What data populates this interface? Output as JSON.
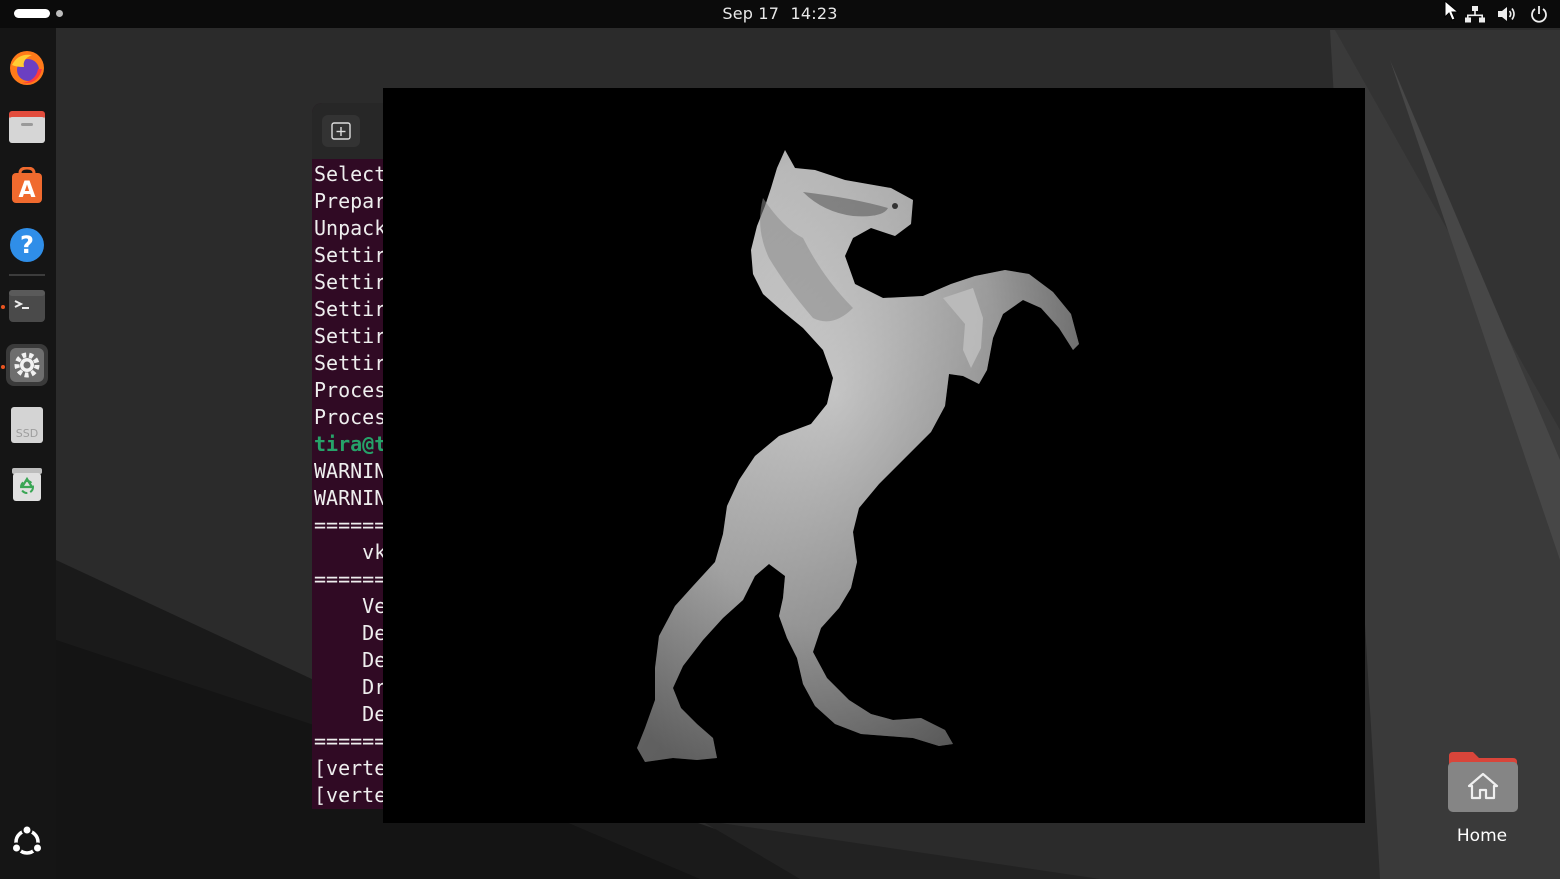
{
  "topbar": {
    "date": "Sep 17",
    "time": "14:23",
    "tray_icons": [
      "network-icon",
      "volume-icon",
      "power-icon"
    ]
  },
  "dock": {
    "items": [
      {
        "name": "firefox-icon",
        "running": false
      },
      {
        "name": "files-icon",
        "running": false
      },
      {
        "name": "app-center-icon",
        "running": false
      },
      {
        "name": "help-icon",
        "running": false
      },
      {
        "name": "terminal-icon",
        "running": true
      },
      {
        "name": "settings-icon",
        "running": true,
        "active": true
      },
      {
        "name": "ssd-drive-icon",
        "running": false
      },
      {
        "name": "trash-icon",
        "running": false
      }
    ],
    "show_apps_icon": "ubuntu-show-apps-icon"
  },
  "terminal": {
    "lines": [
      {
        "text": "Select"
      },
      {
        "text": "Prepar"
      },
      {
        "text": "Unpack"
      },
      {
        "text": "Settir"
      },
      {
        "text": "Settir"
      },
      {
        "text": "Settir"
      },
      {
        "text": "Settir"
      },
      {
        "text": "Settir"
      },
      {
        "text": "Proces"
      },
      {
        "text": "Proces"
      },
      {
        "text": "tira@t",
        "prompt": true
      },
      {
        "text": "WARNIN"
      },
      {
        "text": "WARNIN"
      },
      {
        "text": "======"
      },
      {
        "text": "    vk"
      },
      {
        "text": "======"
      },
      {
        "text": "    Ve"
      },
      {
        "text": "    De"
      },
      {
        "text": "    De"
      },
      {
        "text": "    Dr"
      },
      {
        "text": "    De"
      },
      {
        "text": "======"
      },
      {
        "text": "[verte"
      },
      {
        "text": "[verte"
      }
    ]
  },
  "render_window": {
    "content": "rearing-horse-3d-model",
    "background": "#000000"
  },
  "desktop": {
    "home_label": "Home"
  },
  "colors": {
    "terminal_bg": "#300a24",
    "prompt_green": "#26a269",
    "accent": "#e95420"
  }
}
